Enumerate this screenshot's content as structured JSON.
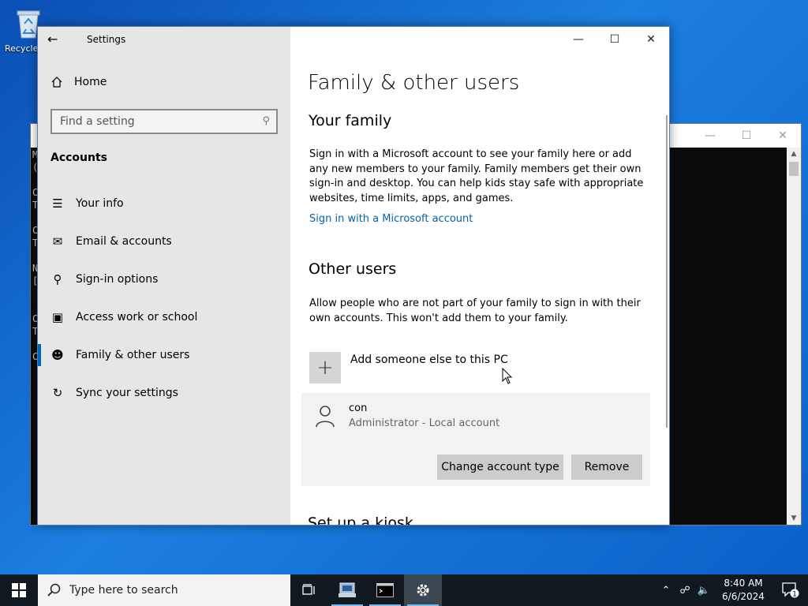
{
  "desktop": {
    "recycle_bin_label": "Recycle Bin"
  },
  "console": {
    "lines": [
      "M",
      "(",
      "",
      "C",
      "T",
      "",
      "C",
      "T",
      "",
      "N",
      "[",
      "",
      "",
      "C",
      "T",
      "",
      "C"
    ]
  },
  "settings": {
    "window_title": "Settings",
    "home_label": "Home",
    "search_placeholder": "Find a setting",
    "section_label": "Accounts",
    "nav": [
      {
        "label": "Your info",
        "icon": "contact-card-icon"
      },
      {
        "label": "Email & accounts",
        "icon": "mail-icon"
      },
      {
        "label": "Sign-in options",
        "icon": "key-icon"
      },
      {
        "label": "Access work or school",
        "icon": "briefcase-icon"
      },
      {
        "label": "Family & other users",
        "icon": "add-person-icon",
        "active": true
      },
      {
        "label": "Sync your settings",
        "icon": "sync-icon"
      }
    ],
    "page_title": "Family & other users",
    "your_family": {
      "heading": "Your family",
      "description": "Sign in with a Microsoft account to see your family here or add any new members to your family. Family members get their own sign-in and desktop. You can help kids stay safe with appropriate websites, time limits, apps, and games.",
      "link": "Sign in with a Microsoft account"
    },
    "other_users": {
      "heading": "Other users",
      "description": "Allow people who are not part of your family to sign in with their own accounts. This won't add them to your family.",
      "add_label": "Add someone else to this PC",
      "user": {
        "name": "con",
        "description": "Administrator - Local account"
      },
      "change_button": "Change account type",
      "remove_button": "Remove"
    },
    "kiosk_heading": "Set up a kiosk"
  },
  "taskbar": {
    "search_placeholder": "Type here to search",
    "time": "8:40 AM",
    "date": "6/6/2024",
    "notification_count": "1",
    "accent": "#76b9ed"
  }
}
